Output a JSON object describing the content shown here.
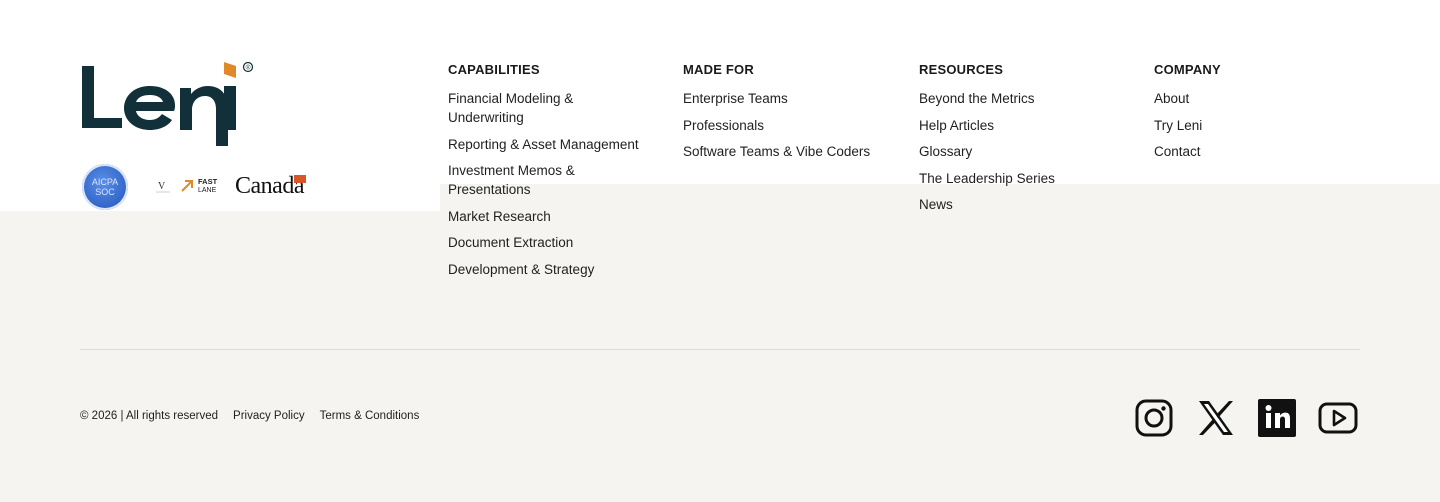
{
  "brand": {
    "logo_text": "Leni",
    "registered_mark": "®"
  },
  "badges": {
    "soc": {
      "line1": "AICPA",
      "line2": "SOC"
    },
    "fastlane": {
      "line1": "FAST",
      "line2": "LANE"
    },
    "canada": "Canada"
  },
  "columns": [
    {
      "heading": "CAPABILITIES",
      "items": [
        "Financial Modeling & Underwriting",
        "Reporting & Asset Management",
        "Investment Memos & Presentations",
        "Market Research",
        "Document Extraction",
        "Development & Strategy"
      ]
    },
    {
      "heading": "MADE FOR",
      "items": [
        "Enterprise Teams",
        "Professionals",
        "Software Teams & Vibe Coders"
      ]
    },
    {
      "heading": "RESOURCES",
      "items": [
        "Beyond the Metrics",
        "Help Articles",
        "Glossary",
        "The Leadership Series",
        "News"
      ]
    },
    {
      "heading": "COMPANY",
      "items": [
        "About",
        "Try Leni",
        "Contact"
      ]
    }
  ],
  "legal": {
    "copyright": "© 2026 | All rights reserved",
    "privacy": "Privacy Policy",
    "terms": "Terms & Conditions"
  },
  "social": [
    {
      "icon": "instagram-icon"
    },
    {
      "icon": "x-icon"
    },
    {
      "icon": "linkedin-icon"
    },
    {
      "icon": "youtube-icon"
    }
  ],
  "colors": {
    "logo_dark": "#12303a",
    "logo_accent": "#e0892a",
    "background": "#f5f4f0"
  }
}
